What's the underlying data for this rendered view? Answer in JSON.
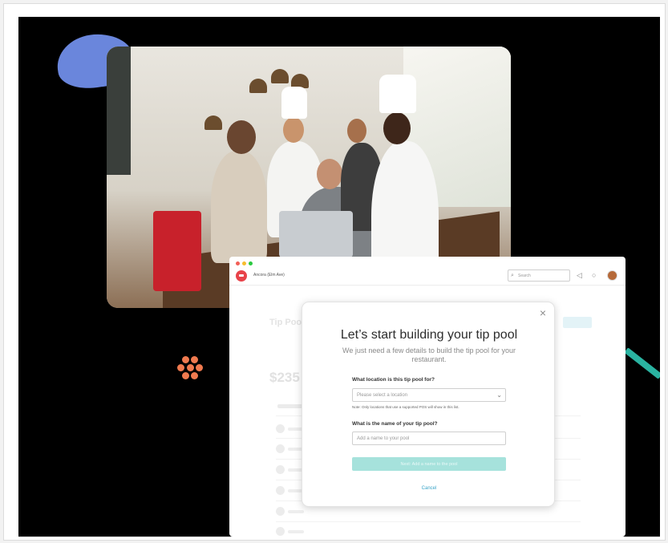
{
  "colors": {
    "blob": "#6a86dc",
    "dots": "#f07a4f",
    "teal_stroke": "#2ab3a1",
    "brand_logo": "#e8434a",
    "cta_bg": "#a6e2dc",
    "link": "#3aa4c8"
  },
  "app": {
    "window_controls": [
      "close",
      "minimize",
      "maximize"
    ],
    "header": {
      "location_name": "Ancora (Elm Ave)",
      "search_placeholder": "Search",
      "icons": [
        "megaphone-icon",
        "chat-icon",
        "avatar"
      ]
    },
    "background": {
      "page_title": "Tip Pool",
      "amount": "$235"
    },
    "modal": {
      "close_glyph": "×",
      "title": "Let’s start building your tip pool",
      "subtitle": "We just need a few details to build the tip pool for your restaurant.",
      "location_label": "What location is this tip pool for?",
      "location_placeholder": "Please select a location",
      "location_note": "Note: Only locations that use a supported POS will show in this list.",
      "name_label": "What is the name of your tip pool?",
      "name_placeholder": "Add a name to your pool",
      "submit_label": "Next: Add a name to the pool",
      "cancel_label": "Cancel"
    }
  }
}
